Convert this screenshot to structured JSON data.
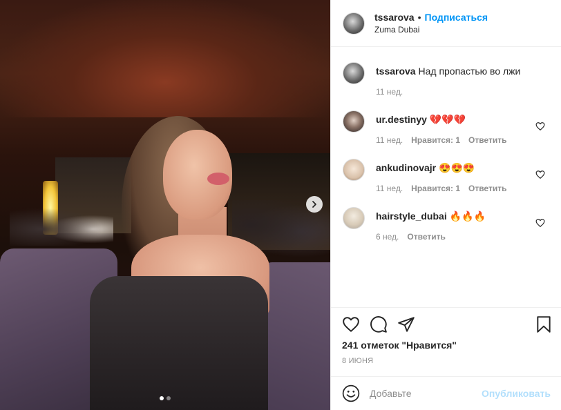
{
  "post": {
    "username": "tssarova",
    "follow_label": "Подписаться",
    "bullet": "•",
    "location": "Zuma Dubai",
    "caption": "Над пропастью во лжи",
    "caption_time": "11 нед.",
    "carousel_dots": 2,
    "carousel_active": 0
  },
  "comments": [
    {
      "user": "ur.destinyy",
      "text": "💔💔💔",
      "time": "11 нед.",
      "likes": "Нравится: 1",
      "reply": "Ответить",
      "avatar": "dark"
    },
    {
      "user": "ankudinovajr",
      "text": "😍😍😍",
      "time": "11 нед.",
      "likes": "Нравится: 1",
      "reply": "Ответить",
      "avatar": "light"
    },
    {
      "user": "hairstyle_dubai",
      "text": "🔥🔥🔥",
      "time": "6 нед.",
      "likes": "",
      "reply": "Ответить",
      "avatar": "blond"
    }
  ],
  "actions": {
    "likes_count": "241 отметок \"Нравится\"",
    "date": "8 ИЮНЯ"
  },
  "add_comment": {
    "placeholder": "Добавьте",
    "publish": "Опубликовать"
  }
}
